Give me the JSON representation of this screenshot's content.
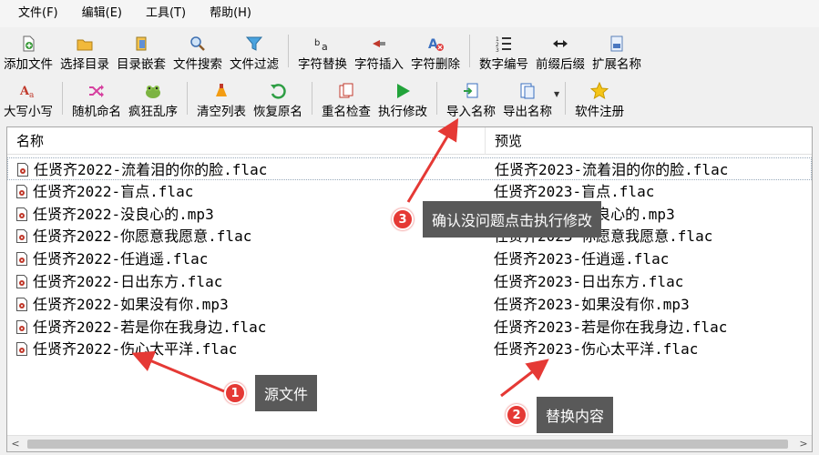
{
  "menu": [
    "文件(F)",
    "编辑(E)",
    "工具(T)",
    "帮助(H)"
  ],
  "toolbar1": [
    {
      "label": "添加文件",
      "icon": "add-file-icon"
    },
    {
      "label": "选择目录",
      "icon": "folder-icon"
    },
    {
      "label": "目录嵌套",
      "icon": "nested-folder-icon"
    },
    {
      "label": "文件搜索",
      "icon": "search-icon"
    },
    {
      "label": "文件过滤",
      "icon": "filter-icon"
    },
    {
      "label": "字符替换",
      "icon": "replace-char-icon"
    },
    {
      "label": "字符插入",
      "icon": "insert-char-icon"
    },
    {
      "label": "字符删除",
      "icon": "delete-char-icon"
    },
    {
      "label": "数字编号",
      "icon": "number-list-icon"
    },
    {
      "label": "前缀后缀",
      "icon": "prefix-suffix-icon"
    },
    {
      "label": "扩展名称",
      "icon": "extension-icon"
    }
  ],
  "toolbar2": [
    {
      "label": "大写小写",
      "icon": "case-icon"
    },
    {
      "label": "随机命名",
      "icon": "shuffle-icon"
    },
    {
      "label": "疯狂乱序",
      "icon": "frog-icon"
    },
    {
      "label": "清空列表",
      "icon": "clear-list-icon"
    },
    {
      "label": "恢复原名",
      "icon": "undo-icon"
    },
    {
      "label": "重名检查",
      "icon": "duplicate-check-icon"
    },
    {
      "label": "执行修改",
      "icon": "play-icon"
    },
    {
      "label": "导入名称",
      "icon": "import-icon"
    },
    {
      "label": "导出名称",
      "icon": "export-icon"
    },
    {
      "label": "软件注册",
      "icon": "star-icon"
    }
  ],
  "list": {
    "col_name": "名称",
    "col_preview": "预览",
    "rows": [
      {
        "src": "任贤齐2022-流着泪的你的脸.flac",
        "prev": "任贤齐2023-流着泪的你的脸.flac"
      },
      {
        "src": "任贤齐2022-盲点.flac",
        "prev": "任贤齐2023-盲点.flac"
      },
      {
        "src": "任贤齐2022-没良心的.mp3",
        "prev": "任贤齐2023-没良心的.mp3"
      },
      {
        "src": "任贤齐2022-你愿意我愿意.flac",
        "prev": "任贤齐2023-你愿意我愿意.flac"
      },
      {
        "src": "任贤齐2022-任逍遥.flac",
        "prev": "任贤齐2023-任逍遥.flac"
      },
      {
        "src": "任贤齐2022-日出东方.flac",
        "prev": "任贤齐2023-日出东方.flac"
      },
      {
        "src": "任贤齐2022-如果没有你.mp3",
        "prev": "任贤齐2023-如果没有你.mp3"
      },
      {
        "src": "任贤齐2022-若是你在我身边.flac",
        "prev": "任贤齐2023-若是你在我身边.flac"
      },
      {
        "src": "任贤齐2022-伤心太平洋.flac",
        "prev": "任贤齐2023-伤心太平洋.flac"
      }
    ]
  },
  "callouts": [
    {
      "num": "1",
      "text": "源文件"
    },
    {
      "num": "2",
      "text": "替换内容"
    },
    {
      "num": "3",
      "text": "确认没问题点击执行修改"
    }
  ],
  "colors": {
    "accent_red": "#e53935",
    "callout_bg": "#595959",
    "play_green": "#22a33a"
  }
}
